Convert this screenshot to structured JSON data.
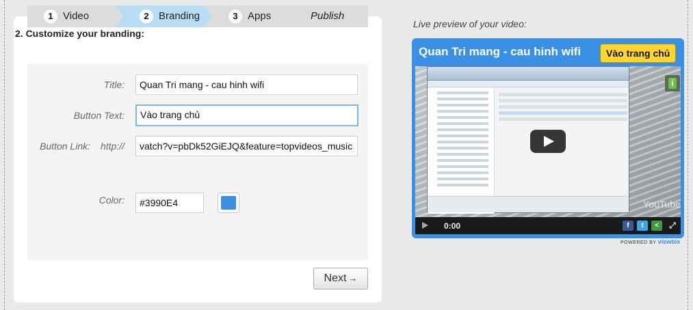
{
  "wizard": {
    "steps": [
      {
        "num": "1",
        "label": "Video"
      },
      {
        "num": "2",
        "label": "Branding"
      },
      {
        "num": "3",
        "label": "Apps"
      },
      {
        "num": "",
        "label": "Publish"
      }
    ],
    "active_step": 2
  },
  "form": {
    "heading": "2. Customize your branding:",
    "title_label": "Title:",
    "title_value": "Quan Tri mang - cau hinh wifi",
    "button_text_label": "Button Text:",
    "button_text_value": "Vào trang chủ",
    "button_link_label": "Button Link:",
    "button_link_prefix": "http://",
    "button_link_value": "vatch?v=pbDk52GiEJQ&feature=topvideos_music",
    "color_label": "Color:",
    "color_value": "#3990E4",
    "next_label": "Next",
    "next_arrow": "→"
  },
  "preview": {
    "label": "Live preview of your video:",
    "title": "Quan Tri mang - cau hinh wifi",
    "cta_label": "Vào trang chủ",
    "time": "0:00",
    "watermark": "YouTube",
    "powered_by": "POWERED BY",
    "brand": "viewbix"
  },
  "colors": {
    "brand": "#3990E4",
    "active_step": "#b7def5",
    "cta": "#ffd630"
  }
}
